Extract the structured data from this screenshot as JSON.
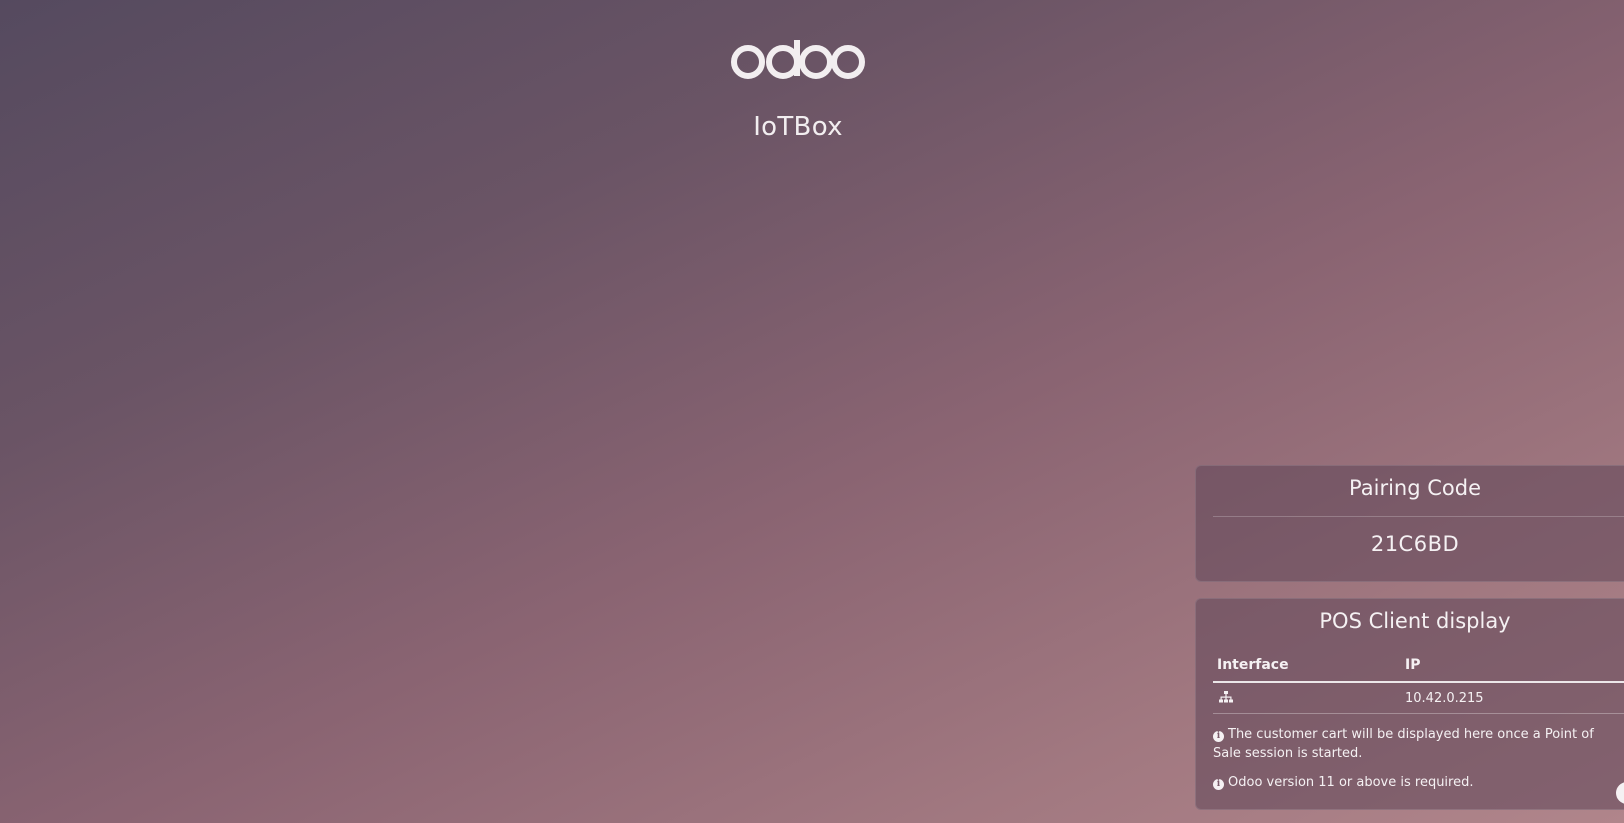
{
  "branding": {
    "logo_text": "odoo",
    "product_name": "IoTBox"
  },
  "pairing": {
    "title": "Pairing Code",
    "code": "21C6BD"
  },
  "pos_display": {
    "title": "POS Client display",
    "columns": {
      "interface": "Interface",
      "ip": "IP"
    },
    "rows": [
      {
        "interface_icon": "network-icon",
        "ip": "10.42.0.215"
      }
    ],
    "notes": [
      {
        "icon": "info-icon",
        "text": "The customer cart will be displayed here once a Point of Sale session is started."
      },
      {
        "icon": "info-icon",
        "text": "Odoo version 11 or above is required."
      }
    ]
  },
  "colors": {
    "background_start": "#554a5f",
    "background_end": "#b0858b",
    "text": "#f5f1f3"
  }
}
